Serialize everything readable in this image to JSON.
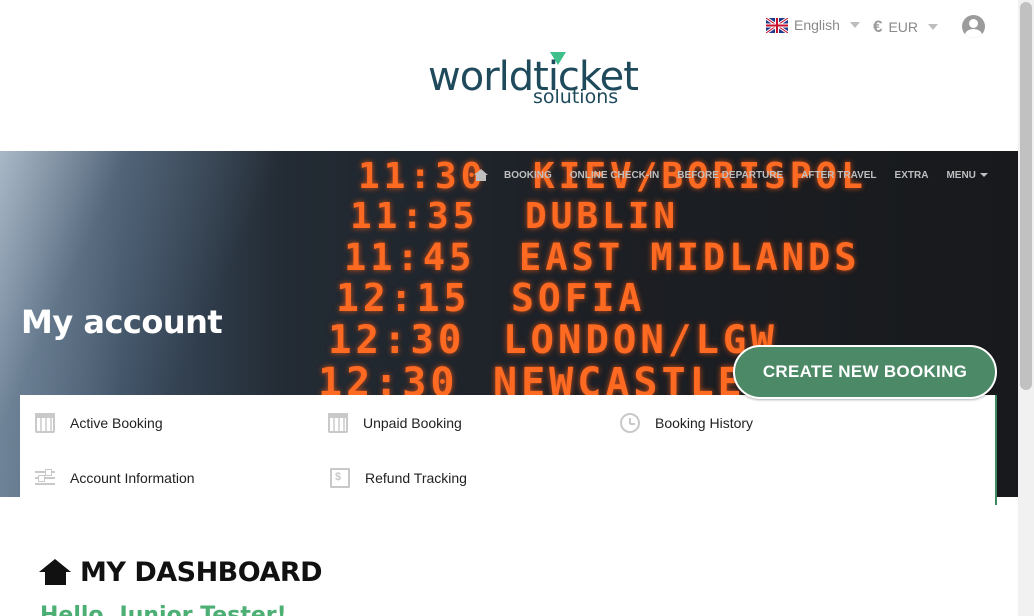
{
  "header": {
    "language": "English",
    "currency_symbol": "€",
    "currency": "EUR",
    "logo_line1": "worldticket",
    "logo_line2": "solutions"
  },
  "nav": {
    "items": [
      "BOOKING",
      "ONLINE CHECK-IN",
      "BEFORE DEPARTURE",
      "AFTER TRAVEL",
      "EXTRA",
      "MENU"
    ]
  },
  "board": {
    "rows": [
      {
        "time": "11:30",
        "dest": "KIEV/BORISPOL"
      },
      {
        "time": "11:35",
        "dest": "DUBLIN"
      },
      {
        "time": "11:45",
        "dest": "EAST MIDLANDS"
      },
      {
        "time": "12:15",
        "dest": "SOFIA"
      },
      {
        "time": "12:30",
        "dest": "LONDON/LGW"
      },
      {
        "time": "12:30",
        "dest": "NEWCASTLE"
      }
    ]
  },
  "page": {
    "title": "My account",
    "create_button": "CREATE NEW BOOKING"
  },
  "account_menu": {
    "active_booking": "Active Booking",
    "unpaid_booking": "Unpaid Booking",
    "booking_history": "Booking History",
    "account_information": "Account Information",
    "refund_tracking": "Refund Tracking"
  },
  "dashboard": {
    "heading": "MY DASHBOARD",
    "greeting": "Hello, Junior Tester!"
  },
  "colors": {
    "accent_green": "#4c8a67",
    "greeting_green": "#4caf74",
    "board_orange": "#ff6a22"
  }
}
